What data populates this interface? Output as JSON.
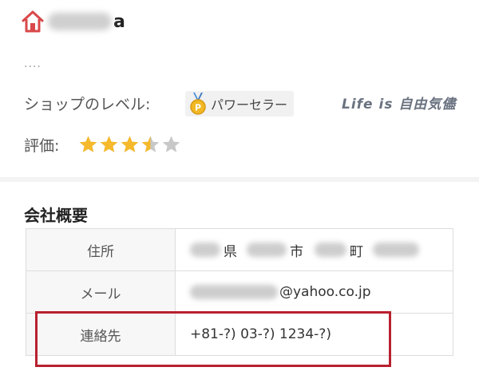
{
  "shop": {
    "name_visible_suffix": "a",
    "ellipsis": "....",
    "level_label": "ショップのレベル:",
    "level_value": "パワーセラー",
    "rating_label": "評価:",
    "rating_stars": 3.5,
    "rating_max": 5
  },
  "watermark": "Life is 自由気儘",
  "company": {
    "title": "会社概要",
    "rows": [
      {
        "key": "住所",
        "ken": "県",
        "shi": "市",
        "machi": "町"
      },
      {
        "key": "メール",
        "domain": "@yahoo.co.jp"
      },
      {
        "key": "連絡先",
        "value": "+81-?) 03-?) 1234-?)"
      }
    ]
  },
  "colors": {
    "home_icon": "#d9484a",
    "star_filled": "#f5b92b",
    "star_empty": "#c8c8c8",
    "highlight_border": "#b8202f"
  }
}
